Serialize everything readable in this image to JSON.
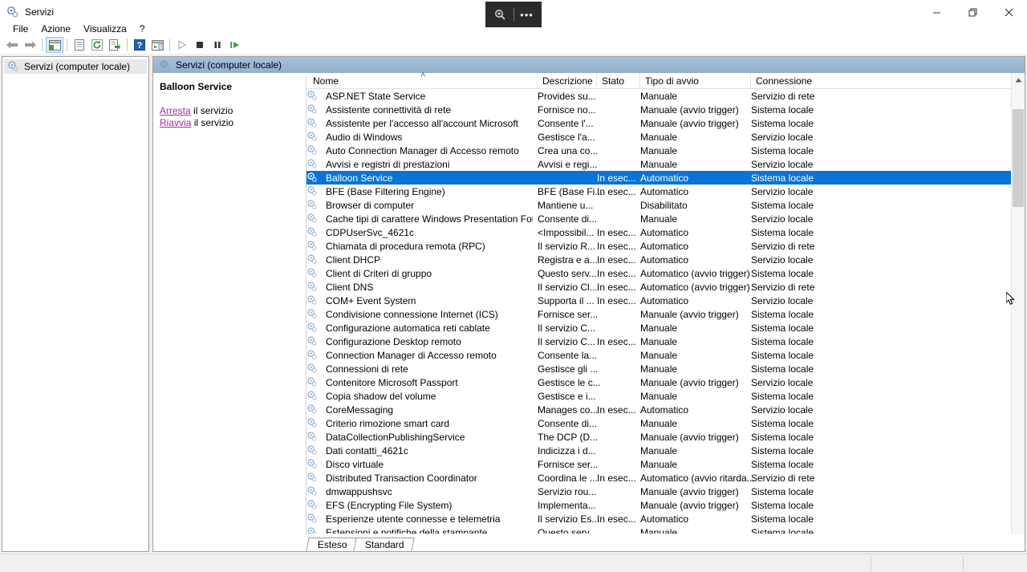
{
  "window": {
    "title": "Servizi",
    "title_icon": "services-gear-icon",
    "minimize_label": "–",
    "maximize_label": "❐",
    "close_label": "✕"
  },
  "float_widget": {
    "zoom_icon": "magnifier-plus-icon",
    "more_label": "•••"
  },
  "menu": {
    "items": [
      {
        "label": "File"
      },
      {
        "label": "Azione"
      },
      {
        "label": "Visualizza"
      },
      {
        "label": "?"
      }
    ]
  },
  "toolbar": {
    "buttons": [
      {
        "name": "back-button",
        "icon": "arrow-left-icon"
      },
      {
        "name": "forward-button",
        "icon": "arrow-right-icon"
      },
      {
        "name": "show-hide-tree-button",
        "icon": "console-tree-icon"
      },
      {
        "name": "properties-button",
        "icon": "properties-icon"
      },
      {
        "name": "refresh-button",
        "icon": "refresh-icon"
      },
      {
        "name": "export-list-button",
        "icon": "export-list-icon"
      },
      {
        "name": "help-button",
        "icon": "help-icon"
      },
      {
        "name": "show-action-pane-button",
        "icon": "action-pane-icon"
      },
      {
        "name": "start-service-button",
        "icon": "play-icon"
      },
      {
        "name": "stop-service-button",
        "icon": "stop-icon"
      },
      {
        "name": "pause-service-button",
        "icon": "pause-icon"
      },
      {
        "name": "restart-service-button",
        "icon": "restart-icon"
      }
    ]
  },
  "tree": {
    "root_label": "Servizi (computer locale)",
    "root_icon": "services-gear-icon"
  },
  "results_pane": {
    "header_label": "Servizi (computer locale)",
    "header_icon": "services-gear-icon"
  },
  "detail": {
    "service_title": "Balloon Service",
    "links": [
      {
        "link": "Arresta",
        "suffix": " il servizio"
      },
      {
        "link": "Riavvia",
        "suffix": " il servizio"
      }
    ]
  },
  "list": {
    "sort_indicator": "˄",
    "columns": [
      {
        "label": "Nome"
      },
      {
        "label": "Descrizione"
      },
      {
        "label": "Stato"
      },
      {
        "label": "Tipo di avvio"
      },
      {
        "label": "Connessione"
      }
    ],
    "rows": [
      {
        "name": "ASP.NET State Service",
        "desc": "Provides su...",
        "stato": "",
        "tipo": "Manuale",
        "conn": "Servizio di rete",
        "selected": false
      },
      {
        "name": "Assistente connettività di rete",
        "desc": "Fornisce no...",
        "stato": "",
        "tipo": "Manuale (avvio trigger)",
        "conn": "Sistema locale",
        "selected": false
      },
      {
        "name": "Assistente per l'accesso all'account Microsoft",
        "desc": "Consente l'...",
        "stato": "",
        "tipo": "Manuale (avvio trigger)",
        "conn": "Sistema locale",
        "selected": false
      },
      {
        "name": "Audio di Windows",
        "desc": "Gestisce l'a...",
        "stato": "",
        "tipo": "Manuale",
        "conn": "Servizio locale",
        "selected": false
      },
      {
        "name": "Auto Connection Manager di Accesso remoto",
        "desc": "Crea una co...",
        "stato": "",
        "tipo": "Manuale",
        "conn": "Sistema locale",
        "selected": false
      },
      {
        "name": "Avvisi e registri di prestazioni",
        "desc": "Avvisi e regi...",
        "stato": "",
        "tipo": "Manuale",
        "conn": "Servizio locale",
        "selected": false
      },
      {
        "name": "Balloon Service",
        "desc": "",
        "stato": "In esec...",
        "tipo": "Automatico",
        "conn": "Sistema locale",
        "selected": true
      },
      {
        "name": "BFE (Base Filtering Engine)",
        "desc": "BFE (Base Fi...",
        "stato": "In esec...",
        "tipo": "Automatico",
        "conn": "Servizio locale",
        "selected": false
      },
      {
        "name": "Browser di computer",
        "desc": "Mantiene u...",
        "stato": "",
        "tipo": "Disabilitato",
        "conn": "Sistema locale",
        "selected": false
      },
      {
        "name": "Cache tipi di carattere Windows Presentation Foundat...",
        "desc": "Consente di...",
        "stato": "",
        "tipo": "Manuale",
        "conn": "Servizio locale",
        "selected": false
      },
      {
        "name": "CDPUserSvc_4621c",
        "desc": "<Impossibil...",
        "stato": "In esec...",
        "tipo": "Automatico",
        "conn": "Sistema locale",
        "selected": false
      },
      {
        "name": "Chiamata di procedura remota (RPC)",
        "desc": "Il servizio R...",
        "stato": "In esec...",
        "tipo": "Automatico",
        "conn": "Servizio di rete",
        "selected": false
      },
      {
        "name": "Client DHCP",
        "desc": "Registra e a...",
        "stato": "In esec...",
        "tipo": "Automatico",
        "conn": "Servizio locale",
        "selected": false
      },
      {
        "name": "Client di Criteri di gruppo",
        "desc": "Questo serv...",
        "stato": "In esec...",
        "tipo": "Automatico (avvio trigger)",
        "conn": "Sistema locale",
        "selected": false
      },
      {
        "name": "Client DNS",
        "desc": "Il servizio Cl...",
        "stato": "In esec...",
        "tipo": "Automatico (avvio trigger)",
        "conn": "Servizio di rete",
        "selected": false
      },
      {
        "name": "COM+ Event System",
        "desc": "Supporta il ...",
        "stato": "In esec...",
        "tipo": "Automatico",
        "conn": "Servizio locale",
        "selected": false
      },
      {
        "name": "Condivisione connessione Internet (ICS)",
        "desc": "Fornisce ser...",
        "stato": "",
        "tipo": "Manuale (avvio trigger)",
        "conn": "Sistema locale",
        "selected": false
      },
      {
        "name": "Configurazione automatica reti cablate",
        "desc": "Il servizio C...",
        "stato": "",
        "tipo": "Manuale",
        "conn": "Sistema locale",
        "selected": false
      },
      {
        "name": "Configurazione Desktop remoto",
        "desc": "Il servizio C...",
        "stato": "In esec...",
        "tipo": "Manuale",
        "conn": "Sistema locale",
        "selected": false
      },
      {
        "name": "Connection Manager di Accesso remoto",
        "desc": "Consente la...",
        "stato": "",
        "tipo": "Manuale",
        "conn": "Sistema locale",
        "selected": false
      },
      {
        "name": "Connessioni di rete",
        "desc": "Gestisce gli ...",
        "stato": "",
        "tipo": "Manuale",
        "conn": "Sistema locale",
        "selected": false
      },
      {
        "name": "Contenitore Microsoft Passport",
        "desc": "Gestisce le c...",
        "stato": "",
        "tipo": "Manuale (avvio trigger)",
        "conn": "Servizio locale",
        "selected": false
      },
      {
        "name": "Copia shadow del volume",
        "desc": "Gestisce e i...",
        "stato": "",
        "tipo": "Manuale",
        "conn": "Sistema locale",
        "selected": false
      },
      {
        "name": "CoreMessaging",
        "desc": "Manages co...",
        "stato": "In esec...",
        "tipo": "Automatico",
        "conn": "Servizio locale",
        "selected": false
      },
      {
        "name": "Criterio rimozione smart card",
        "desc": "Consente di...",
        "stato": "",
        "tipo": "Manuale",
        "conn": "Sistema locale",
        "selected": false
      },
      {
        "name": "DataCollectionPublishingService",
        "desc": "The DCP (D...",
        "stato": "",
        "tipo": "Manuale (avvio trigger)",
        "conn": "Sistema locale",
        "selected": false
      },
      {
        "name": "Dati contatti_4621c",
        "desc": "Indicizza i d...",
        "stato": "",
        "tipo": "Manuale",
        "conn": "Sistema locale",
        "selected": false
      },
      {
        "name": "Disco virtuale",
        "desc": "Fornisce ser...",
        "stato": "",
        "tipo": "Manuale",
        "conn": "Sistema locale",
        "selected": false
      },
      {
        "name": "Distributed Transaction Coordinator",
        "desc": "Coordina le ...",
        "stato": "In esec...",
        "tipo": "Automatico (avvio ritarda...",
        "conn": "Servizio di rete",
        "selected": false
      },
      {
        "name": "dmwappushsvc",
        "desc": "Servizio rou...",
        "stato": "",
        "tipo": "Manuale (avvio trigger)",
        "conn": "Sistema locale",
        "selected": false
      },
      {
        "name": "EFS (Encrypting File System)",
        "desc": "Implementa...",
        "stato": "",
        "tipo": "Manuale (avvio trigger)",
        "conn": "Sistema locale",
        "selected": false
      },
      {
        "name": "Esperienze utente connesse e telemetria",
        "desc": "Il servizio Es...",
        "stato": "In esec...",
        "tipo": "Automatico",
        "conn": "Sistema locale",
        "selected": false
      },
      {
        "name": "Estensioni e notifiche della stampante",
        "desc": "Questo serv...",
        "stato": "",
        "tipo": "Manuale",
        "conn": "Sistema locale",
        "selected": false
      }
    ]
  },
  "tabs": [
    {
      "label": "Esteso",
      "active": false
    },
    {
      "label": "Standard",
      "active": true
    }
  ],
  "colors": {
    "selection_blue": "#0a74d4",
    "header_blue": "#93aecd",
    "link_purple": "#a0309a"
  }
}
